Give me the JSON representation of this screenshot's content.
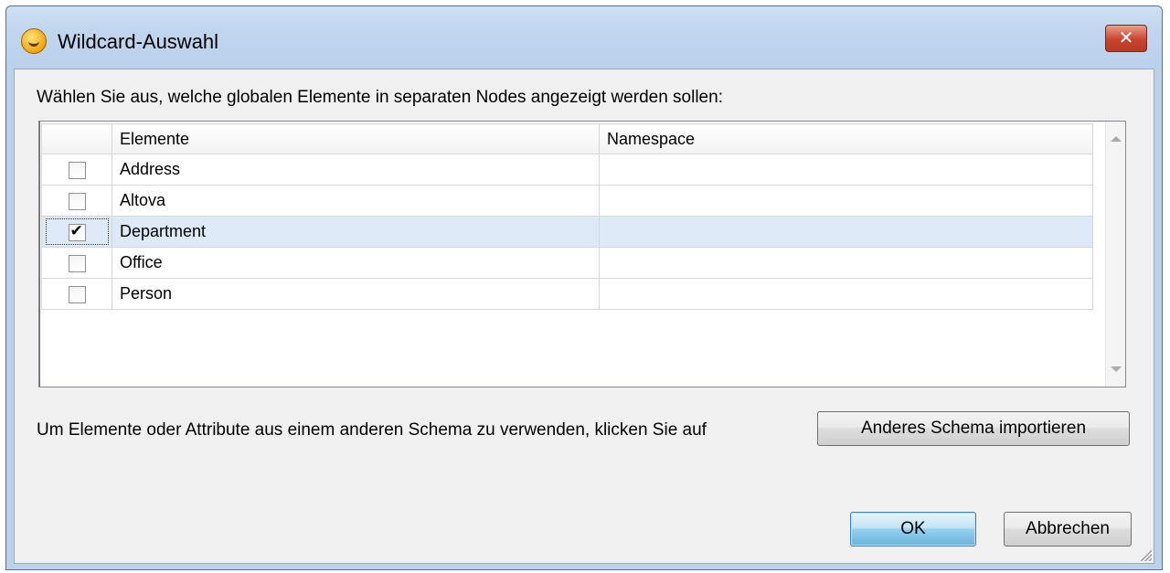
{
  "window": {
    "title": "Wildcard-Auswahl",
    "close_label": "✕"
  },
  "dialog": {
    "instruction": "Wählen Sie aus, welche globalen Elemente in separaten Nodes angezeigt werden sollen:",
    "columns": [
      "",
      "Elemente",
      "Namespace"
    ],
    "rows": [
      {
        "element": "Address",
        "namespace": "",
        "checked": false
      },
      {
        "element": "Altova",
        "namespace": "",
        "checked": false
      },
      {
        "element": "Department",
        "namespace": "",
        "checked": true
      },
      {
        "element": "Office",
        "namespace": "",
        "checked": false
      },
      {
        "element": "Person",
        "namespace": "",
        "checked": false
      }
    ],
    "import_text": "Um Elemente oder Attribute aus einem anderen Schema zu verwenden, klicken Sie auf",
    "import_button": "Anderes Schema importieren",
    "ok_button": "OK",
    "cancel_button": "Abbrechen"
  },
  "colors": {
    "title_gradient": "#c2d6ee",
    "selected_row": "#dde9f6",
    "close_button": "#c9432d"
  },
  "icons": {
    "app": "altova-smiley-icon",
    "close": "close-icon",
    "checkbox": "checkbox-icon"
  }
}
